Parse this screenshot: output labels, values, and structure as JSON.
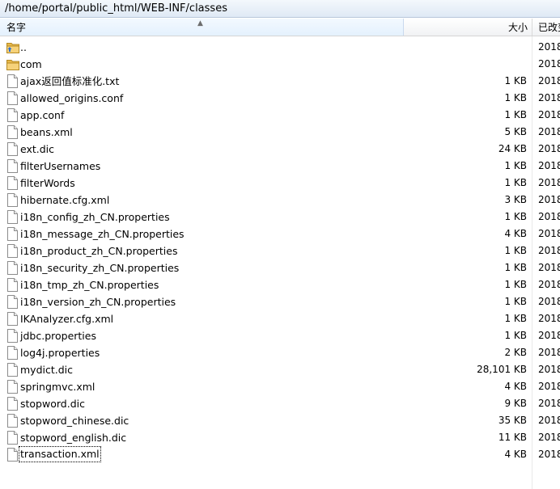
{
  "path": "/home/portal/public_html/WEB-INF/classes",
  "columns": {
    "name": "名字",
    "size": "大小",
    "date": "已改变"
  },
  "files": [
    {
      "name": "..",
      "size": "",
      "date": "2018",
      "icon": "up-folder-icon"
    },
    {
      "name": "com",
      "size": "",
      "date": "2018",
      "icon": "folder-icon"
    },
    {
      "name": "ajax返回值标准化.txt",
      "size": "1 KB",
      "date": "2018",
      "icon": "file-icon"
    },
    {
      "name": "allowed_origins.conf",
      "size": "1 KB",
      "date": "2018",
      "icon": "file-icon"
    },
    {
      "name": "app.conf",
      "size": "1 KB",
      "date": "2018",
      "icon": "file-icon"
    },
    {
      "name": "beans.xml",
      "size": "5 KB",
      "date": "2018",
      "icon": "file-icon"
    },
    {
      "name": "ext.dic",
      "size": "24 KB",
      "date": "2018",
      "icon": "file-icon"
    },
    {
      "name": "filterUsernames",
      "size": "1 KB",
      "date": "2018",
      "icon": "file-icon"
    },
    {
      "name": "filterWords",
      "size": "1 KB",
      "date": "2018",
      "icon": "file-icon"
    },
    {
      "name": "hibernate.cfg.xml",
      "size": "3 KB",
      "date": "2018",
      "icon": "file-icon"
    },
    {
      "name": "i18n_config_zh_CN.properties",
      "size": "1 KB",
      "date": "2018",
      "icon": "file-icon"
    },
    {
      "name": "i18n_message_zh_CN.properties",
      "size": "4 KB",
      "date": "2018",
      "icon": "file-icon"
    },
    {
      "name": "i18n_product_zh_CN.properties",
      "size": "1 KB",
      "date": "2018",
      "icon": "file-icon"
    },
    {
      "name": "i18n_security_zh_CN.properties",
      "size": "1 KB",
      "date": "2018",
      "icon": "file-icon"
    },
    {
      "name": "i18n_tmp_zh_CN.properties",
      "size": "1 KB",
      "date": "2018",
      "icon": "file-icon"
    },
    {
      "name": "i18n_version_zh_CN.properties",
      "size": "1 KB",
      "date": "2018",
      "icon": "file-icon"
    },
    {
      "name": "IKAnalyzer.cfg.xml",
      "size": "1 KB",
      "date": "2018",
      "icon": "file-icon"
    },
    {
      "name": "jdbc.properties",
      "size": "1 KB",
      "date": "2018",
      "icon": "file-icon"
    },
    {
      "name": "log4j.properties",
      "size": "2 KB",
      "date": "2018",
      "icon": "file-icon"
    },
    {
      "name": "mydict.dic",
      "size": "28,101 KB",
      "date": "2018",
      "icon": "file-icon"
    },
    {
      "name": "springmvc.xml",
      "size": "4 KB",
      "date": "2018",
      "icon": "file-icon"
    },
    {
      "name": "stopword.dic",
      "size": "9 KB",
      "date": "2018",
      "icon": "file-icon"
    },
    {
      "name": "stopword_chinese.dic",
      "size": "35 KB",
      "date": "2018",
      "icon": "file-icon"
    },
    {
      "name": "stopword_english.dic",
      "size": "11 KB",
      "date": "2018",
      "icon": "file-icon"
    },
    {
      "name": "transaction.xml",
      "size": "4 KB",
      "date": "2018",
      "icon": "file-icon"
    }
  ]
}
